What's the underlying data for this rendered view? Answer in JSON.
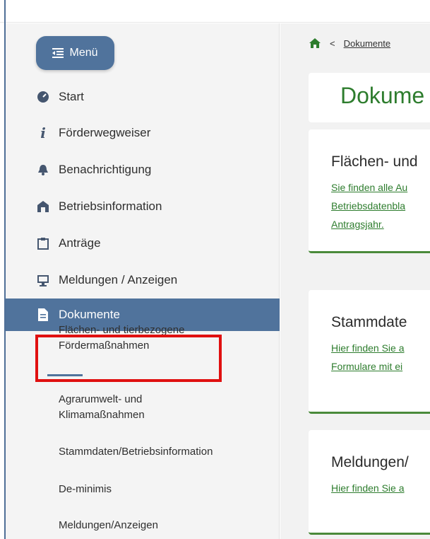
{
  "menu_button": {
    "label": "Menü"
  },
  "nav": [
    {
      "label": "Start",
      "icon": "dashboard-icon"
    },
    {
      "label": "Förderwegweiser",
      "icon": "info-icon"
    },
    {
      "label": "Benachrichtigung",
      "icon": "bell-icon"
    },
    {
      "label": "Betriebsinformation",
      "icon": "barn-icon"
    },
    {
      "label": "Anträge",
      "icon": "clipboard-icon"
    },
    {
      "label": "Meldungen / Anzeigen",
      "icon": "monitor-icon"
    },
    {
      "label": "Dokumente",
      "icon": "document-icon",
      "active": true
    }
  ],
  "sub_nav": [
    {
      "label": "Flächen- und tierbezogene Fördermaßnahmen",
      "selected": true
    },
    {
      "label": "Agrarumwelt- und Klimamaßnahmen"
    },
    {
      "label": "Stammdaten/Betriebsinformation"
    },
    {
      "label": "De-minimis"
    },
    {
      "label": "Meldungen/Anzeigen"
    }
  ],
  "breadcrumb": {
    "separator": "<",
    "current": "Dokumente"
  },
  "page_title": "Dokume",
  "cards": [
    {
      "heading": "Flächen- und",
      "lines": [
        "Sie finden alle Au",
        "Betriebsdatenbla",
        "Antragsjahr."
      ]
    },
    {
      "heading": "Stammdate",
      "lines": [
        "Hier finden Sie a",
        "Formulare mit ei"
      ]
    },
    {
      "heading": "Meldungen/",
      "lines": [
        "Hier finden Sie a"
      ]
    }
  ],
  "colors": {
    "primary": "#50739c",
    "accent_green": "#2e7d2e",
    "highlight": "#e01010"
  }
}
